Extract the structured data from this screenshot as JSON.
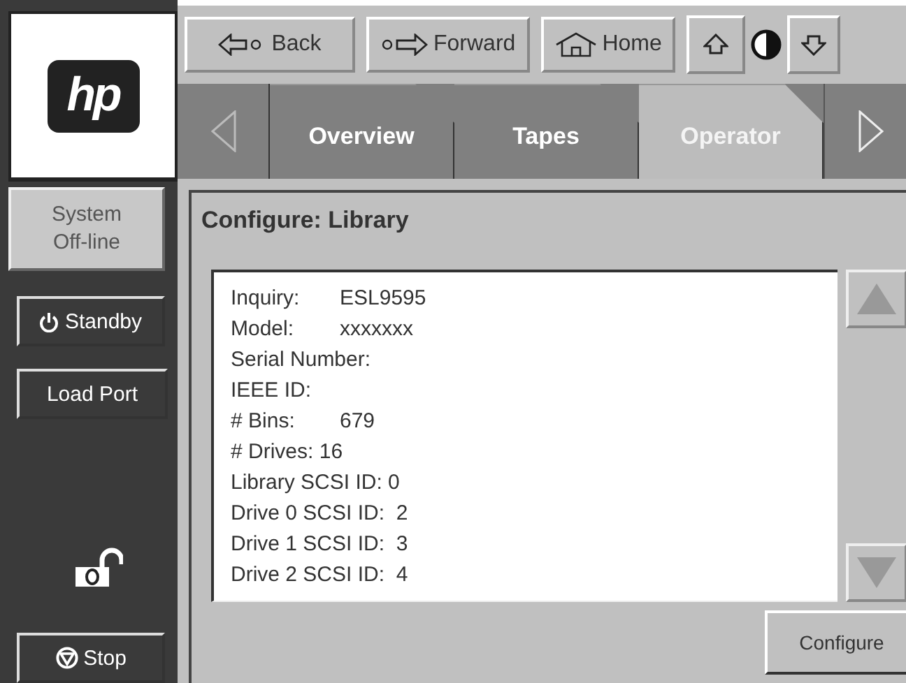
{
  "logo": {
    "text": "hp"
  },
  "side_panel": {
    "status": [
      "System",
      "Off-line"
    ],
    "buttons": [
      {
        "kind": "standby",
        "label": "Standby"
      },
      {
        "kind": "plain",
        "label": "Load Port"
      }
    ],
    "locked": false,
    "stop": {
      "label": "Stop"
    }
  },
  "nav": [
    {
      "kind": "back",
      "label": "Back"
    },
    {
      "kind": "forward",
      "label": "Forward"
    },
    {
      "kind": "home",
      "label": "Home"
    }
  ],
  "tabs": [
    {
      "label": "Overview",
      "selected": false
    },
    {
      "label": "Tapes",
      "selected": false
    },
    {
      "label": "Operator",
      "selected": true
    }
  ],
  "panel": {
    "title": "Configure: Library",
    "lines": [
      {
        "kind": "pair",
        "label": "Inquiry:",
        "value": "ESL9595"
      },
      {
        "kind": "pair",
        "label": "Model:",
        "value": "xxxxxxx"
      },
      {
        "kind": "text",
        "text": "Serial Number:"
      },
      {
        "kind": "text",
        "text": "IEEE ID:"
      },
      {
        "kind": "pair",
        "label": "# Bins:",
        "value": "679"
      },
      {
        "kind": "text",
        "text": "# Drives: 16"
      },
      {
        "kind": "text",
        "text": "Library SCSI ID: 0"
      },
      {
        "kind": "text",
        "text": "Drive 0 SCSI ID:  2"
      },
      {
        "kind": "text",
        "text": "Drive 1 SCSI ID:  3"
      },
      {
        "kind": "text",
        "text": "Drive 2 SCSI ID:  4"
      }
    ],
    "action": "Configure"
  }
}
